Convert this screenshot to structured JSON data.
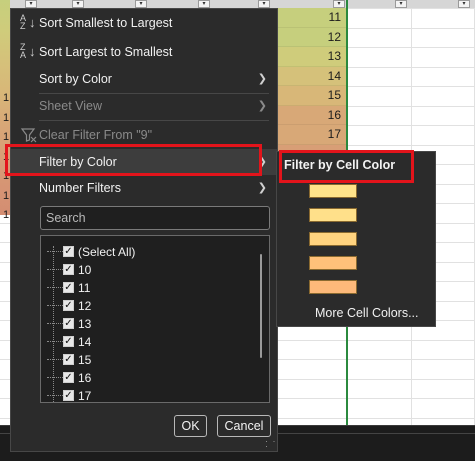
{
  "colors": {
    "menu_bg": "#2b2b2b",
    "highlight_box": "#e3141b",
    "heat_column": [
      "#c6cf7d",
      "#cfcc7b",
      "#d5c17a",
      "#d8b778",
      "#d8a877",
      "#d89e76",
      "#d69574",
      "#d48d72"
    ],
    "swatches": [
      "#ffe38a",
      "#ffe08a",
      "#ffd37f",
      "#ffc17a",
      "#fdb97a"
    ]
  },
  "sheet": {
    "column_values": [
      "11",
      "12",
      "13",
      "14",
      "15",
      "16",
      "17"
    ],
    "left_partial": [
      "1",
      "1",
      "1",
      "1",
      "1",
      "1",
      "1"
    ]
  },
  "menu": {
    "sort_asc": {
      "label": "Sort Smallest to Largest",
      "icon": "sort-ascending-icon"
    },
    "sort_desc": {
      "label": "Sort Largest to Smallest",
      "icon": "sort-descending-icon"
    },
    "sort_by_color": "Sort by Color",
    "sheet_view": "Sheet View",
    "clear_filter": {
      "label": "Clear Filter From \"9\"",
      "icon": "filter-clear-icon"
    },
    "filter_by_color": "Filter by Color",
    "number_filters": "Number Filters",
    "search_placeholder": "Search",
    "items": [
      "(Select All)",
      "10",
      "11",
      "12",
      "13",
      "14",
      "15",
      "16",
      "17"
    ],
    "ok": "OK",
    "cancel": "Cancel"
  },
  "submenu": {
    "title": "Filter by Cell Color",
    "more": "More Cell Colors..."
  }
}
